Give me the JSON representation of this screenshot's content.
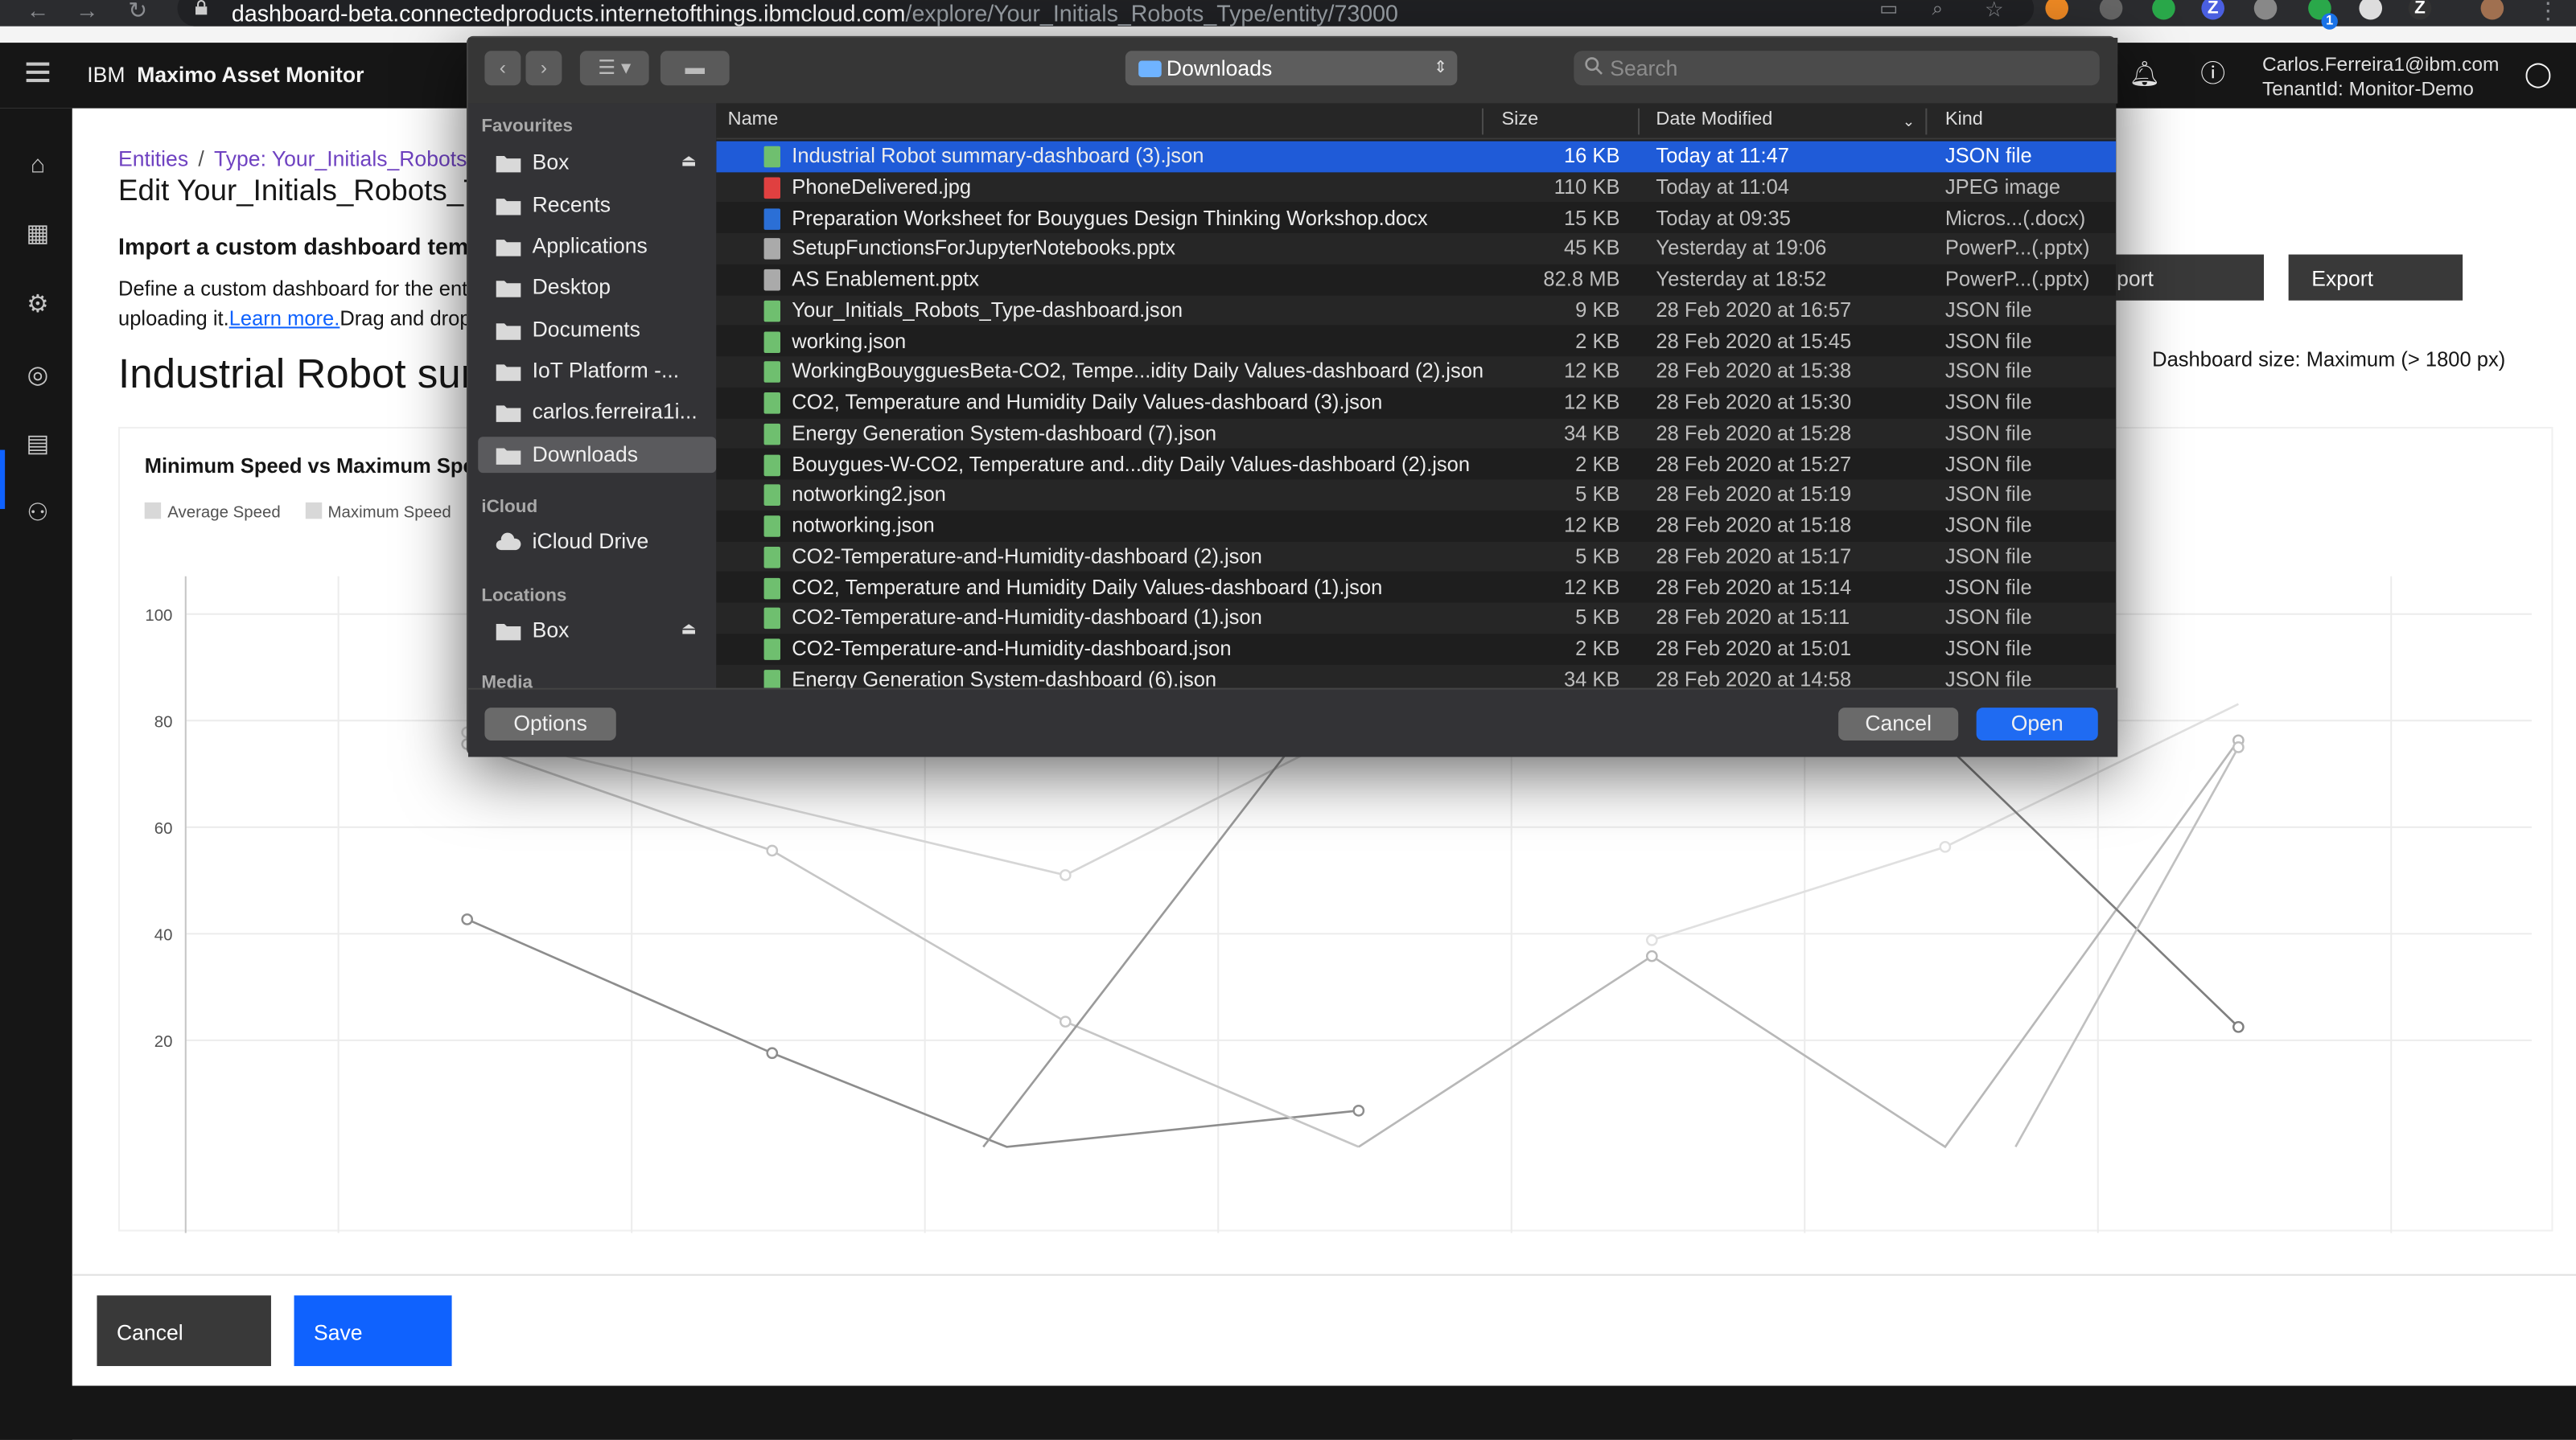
{
  "browser": {
    "url_host": "dashboard-beta.connectedproducts.internetofthings.ibmcloud.com",
    "url_path": "/explore/Your_Initials_Robots_Type/entity/73000",
    "extension_badge": "1"
  },
  "header": {
    "brand_prefix": "IBM",
    "brand_name": "Maximo Asset Monitor",
    "user_email": "Carlos.Ferreira1@ibm.com",
    "tenant": "TenantId: Monitor-Demo"
  },
  "breadcrumb": {
    "entities": "Entities",
    "sep": "/",
    "type": "Type: Your_Initials_Robots_Type"
  },
  "page": {
    "title": "Edit Your_Initials_Robots_Type",
    "import_title": "Import a custom dashboard template",
    "import_desc_1": "Define a custom dashboard for the entity type by",
    "import_desc_2a": "uploading it.",
    "learn_more": "Learn more.",
    "import_desc_2b": "Drag and drop a JSON file",
    "dashboard_title": "Industrial Robot summary",
    "import_label": "Import",
    "export_label": "Export",
    "dashboard_size": "Dashboard size: Maximum (> 1800 px)"
  },
  "chart_data": {
    "type": "line",
    "title": "Minimum Speed vs Maximum Speed",
    "legend": [
      "Average Speed",
      "Maximum Speed"
    ],
    "y_ticks": [
      "100",
      "80",
      "60",
      "40",
      "20"
    ],
    "ylim": [
      0,
      105
    ],
    "grid": true,
    "series": [
      {
        "name": "Average Speed",
        "color": "#8d8d8d",
        "points": [
          [
            0.12,
            42.7
          ],
          [
            0.25,
            17.6
          ],
          [
            0.35,
            0
          ],
          [
            0.5,
            6.8
          ]
        ]
      },
      {
        "name": "Maximum Speed",
        "color": "#c6c6c6",
        "points": [
          [
            0.12,
            75.6
          ],
          [
            0.25,
            55.6
          ],
          [
            0.375,
            23.5
          ],
          [
            0.5,
            0
          ]
        ]
      },
      {
        "name": "",
        "color": "#d6d6d6",
        "points": [
          [
            0.12,
            77.8
          ],
          [
            0.375,
            51.0
          ],
          [
            0.505,
            80
          ]
        ]
      },
      {
        "name": "",
        "color": "#b8b8b8",
        "points": [
          [
            0.5,
            0
          ],
          [
            0.625,
            35.8
          ],
          [
            0.75,
            0
          ],
          [
            0.875,
            76.3
          ]
        ]
      },
      {
        "name": "",
        "color": "#e0e0e0",
        "points": [
          [
            0.625,
            38.8
          ],
          [
            0.75,
            56.3
          ],
          [
            0.875,
            83.1
          ]
        ]
      },
      {
        "name": "",
        "color": "#7f7f7f",
        "points": [
          [
            0.78,
            80
          ],
          [
            0.75,
            75.6
          ],
          [
            0.875,
            22.5
          ]
        ]
      },
      {
        "name": "",
        "color": "#9a9a9a",
        "points": [
          [
            0.34,
            0
          ],
          [
            0.48,
            80
          ]
        ]
      },
      {
        "name": "",
        "color": "#c0c0c0",
        "points": [
          [
            0.78,
            0
          ],
          [
            0.875,
            75
          ]
        ]
      }
    ]
  },
  "footer": {
    "cancel": "Cancel",
    "save": "Save"
  },
  "dialog": {
    "location": "Downloads",
    "search_placeholder": "Search",
    "sections": {
      "favourites": "Favourites",
      "icloud": "iCloud",
      "locations": "Locations",
      "media": "Media"
    },
    "favourites": [
      "Box",
      "Recents",
      "Applications",
      "Desktop",
      "Documents",
      "IoT Platform -...",
      "carlos.ferreira1i...",
      "Downloads"
    ],
    "icloud_items": [
      "iCloud Drive"
    ],
    "location_items": [
      "Box"
    ],
    "columns": {
      "name": "Name",
      "size": "Size",
      "date": "Date Modified",
      "kind": "Kind"
    },
    "files": [
      {
        "name": "Industrial Robot summary-dashboard (3).json",
        "size": "16 KB",
        "date": "Today at 11:47",
        "kind": "JSON file",
        "icon": "json"
      },
      {
        "name": "PhoneDelivered.jpg",
        "size": "110 KB",
        "date": "Today at 11:04",
        "kind": "JPEG image",
        "icon": "jpg"
      },
      {
        "name": "Preparation Worksheet for Bouygues Design Thinking Workshop.docx",
        "size": "15 KB",
        "date": "Today at 09:35",
        "kind": "Micros...(.docx)",
        "icon": "docx"
      },
      {
        "name": "SetupFunctionsForJupyterNotebooks.pptx",
        "size": "45 KB",
        "date": "Yesterday at 19:06",
        "kind": "PowerP...(.pptx)",
        "icon": "pptx"
      },
      {
        "name": "AS Enablement.pptx",
        "size": "82.8 MB",
        "date": "Yesterday at 18:52",
        "kind": "PowerP...(.pptx)",
        "icon": "pptx"
      },
      {
        "name": "Your_Initials_Robots_Type-dashboard.json",
        "size": "9 KB",
        "date": "28 Feb 2020 at 16:57",
        "kind": "JSON file",
        "icon": "json"
      },
      {
        "name": "working.json",
        "size": "2 KB",
        "date": "28 Feb 2020 at 15:45",
        "kind": "JSON file",
        "icon": "json"
      },
      {
        "name": "WorkingBouygguesBeta-CO2, Tempe...idity Daily Values-dashboard (2).json",
        "size": "12 KB",
        "date": "28 Feb 2020 at 15:38",
        "kind": "JSON file",
        "icon": "json"
      },
      {
        "name": "CO2, Temperature and Humidity Daily Values-dashboard (3).json",
        "size": "12 KB",
        "date": "28 Feb 2020 at 15:30",
        "kind": "JSON file",
        "icon": "json"
      },
      {
        "name": "Energy Generation System-dashboard (7).json",
        "size": "34 KB",
        "date": "28 Feb 2020 at 15:28",
        "kind": "JSON file",
        "icon": "json"
      },
      {
        "name": "Bouygues-W-CO2, Temperature and...dity Daily Values-dashboard (2).json",
        "size": "2 KB",
        "date": "28 Feb 2020 at 15:27",
        "kind": "JSON file",
        "icon": "json"
      },
      {
        "name": "notworking2.json",
        "size": "5 KB",
        "date": "28 Feb 2020 at 15:19",
        "kind": "JSON file",
        "icon": "json"
      },
      {
        "name": "notworking.json",
        "size": "12 KB",
        "date": "28 Feb 2020 at 15:18",
        "kind": "JSON file",
        "icon": "json"
      },
      {
        "name": "CO2-Temperature-and-Humidity-dashboard (2).json",
        "size": "5 KB",
        "date": "28 Feb 2020 at 15:17",
        "kind": "JSON file",
        "icon": "json"
      },
      {
        "name": "CO2, Temperature and Humidity Daily Values-dashboard (1).json",
        "size": "12 KB",
        "date": "28 Feb 2020 at 15:14",
        "kind": "JSON file",
        "icon": "json"
      },
      {
        "name": "CO2-Temperature-and-Humidity-dashboard (1).json",
        "size": "5 KB",
        "date": "28 Feb 2020 at 15:11",
        "kind": "JSON file",
        "icon": "json"
      },
      {
        "name": "CO2-Temperature-and-Humidity-dashboard.json",
        "size": "2 KB",
        "date": "28 Feb 2020 at 15:01",
        "kind": "JSON file",
        "icon": "json"
      },
      {
        "name": "Energy Generation System-dashboard (6).json",
        "size": "34 KB",
        "date": "28 Feb 2020 at 14:58",
        "kind": "JSON file",
        "icon": "json"
      }
    ],
    "options": "Options",
    "cancel": "Cancel",
    "open": "Open"
  },
  "colors": {
    "accent": "#0f62fe",
    "selection": "#1f5bd8",
    "shell": "#161616"
  }
}
